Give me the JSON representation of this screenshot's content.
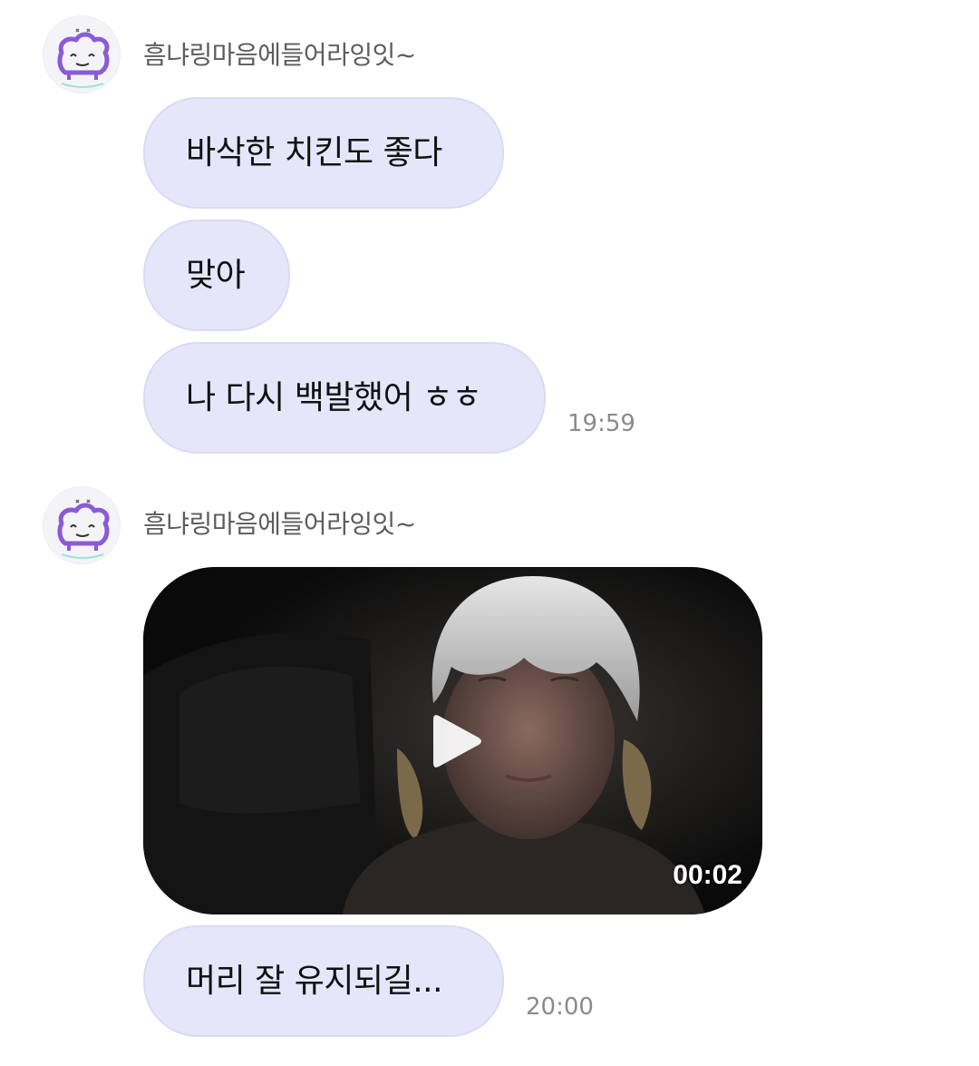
{
  "colors": {
    "bubble_bg": "#e6e6fb",
    "bubble_border": "#dadaf5",
    "sender_text": "#5c5c5c",
    "timestamp_text": "#8a8a8a",
    "avatar_accent": "#8a5bd6"
  },
  "groups": [
    {
      "sender": "흠냐링마음에들어라잉잇~",
      "avatar_icon": "cute-bread-character-icon",
      "messages": [
        {
          "text": "바삭한 치킨도 좋다"
        },
        {
          "text": "맞아"
        },
        {
          "text": "나 다시 백발했어 ㅎㅎ",
          "time": "19:59"
        }
      ]
    },
    {
      "sender": "흠냐링마음에들어라잉잇~",
      "avatar_icon": "cute-bread-character-icon",
      "video": {
        "duration": "00:02",
        "play_icon": "play-icon"
      },
      "messages": [
        {
          "text": "머리 잘 유지되길...",
          "time": "20:00"
        }
      ]
    }
  ]
}
